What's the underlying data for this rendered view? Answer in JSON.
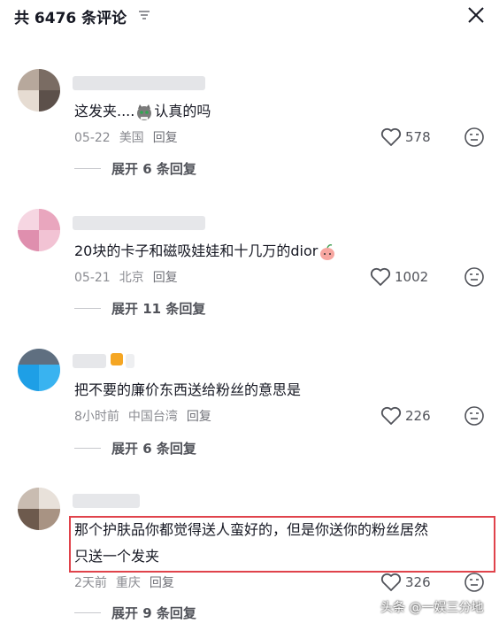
{
  "header": {
    "title": "共 6476 条评论",
    "sort_icon": "filter-lines-icon",
    "close_icon": "close-x-icon"
  },
  "comments": [
    {
      "text_before_emoji": "这发夹....",
      "emoji": "cat-emoji",
      "text_after_emoji": "认真的吗",
      "date": "05-22",
      "location": "美国",
      "reply_label": "回复",
      "likes": "578",
      "expand_label": "展开 6 条回复"
    },
    {
      "text_before_emoji": "20块的卡子和磁吸娃娃和十几万的dior",
      "emoji": "peach-emoji",
      "text_after_emoji": "",
      "date": "05-21",
      "location": "北京",
      "reply_label": "回复",
      "likes": "1002",
      "expand_label": "展开 11 条回复"
    },
    {
      "text_before_emoji": "把不要的廉价东西送给粉丝的意思是",
      "emoji": "",
      "text_after_emoji": "",
      "date": "8小时前",
      "location": "中国台湾",
      "reply_label": "回复",
      "likes": "226",
      "expand_label": "展开 6 条回复"
    },
    {
      "text_line1": "那个护肤品你都觉得送人蛮好的，但是你送你的粉丝居然",
      "text_line2": "只送一个发夹",
      "date": "2天前",
      "location": "重庆",
      "reply_label": "回复",
      "likes": "326",
      "expand_label": "展开 9 条回复"
    }
  ],
  "watermark": "头条 @一娱三分地",
  "colors": {
    "highlight_border": "#e0434b",
    "meta_text": "#8a8b91"
  }
}
